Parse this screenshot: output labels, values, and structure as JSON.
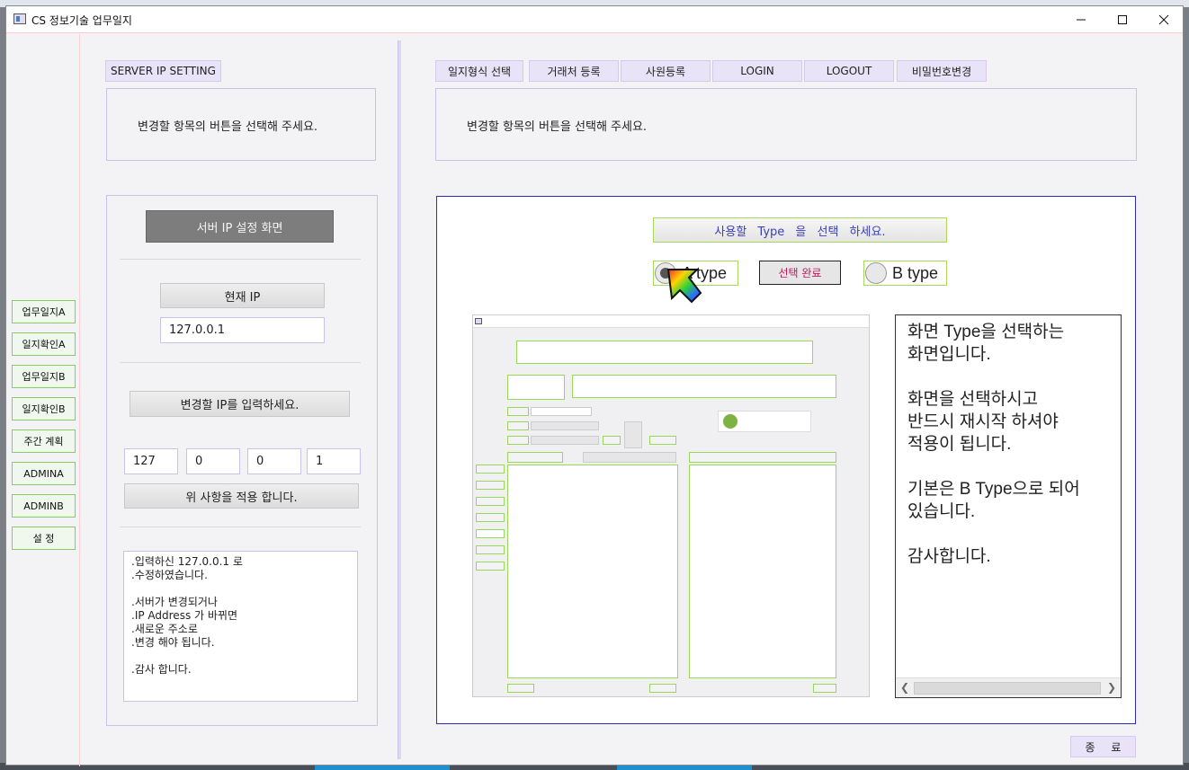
{
  "window": {
    "title": "CS 정보기술 업무일지"
  },
  "sidebar": {
    "items": [
      {
        "label": "업무일지A"
      },
      {
        "label": "일지확인A"
      },
      {
        "label": "업무일지B"
      },
      {
        "label": "일지확인B"
      },
      {
        "label": "주간 계획"
      },
      {
        "label": "ADMINA"
      },
      {
        "label": "ADMINB"
      },
      {
        "label": "설  정"
      }
    ]
  },
  "server": {
    "tab_label": "SERVER IP SETTING",
    "hint": "변경할 항목의 버튼을 선택해 주세요.",
    "screen_title": "서버 IP 설정 화면",
    "current_ip_label": "현재  IP",
    "current_ip_value": "127.0.0.1",
    "input_prompt": "변경할 IP를 입력하세요.",
    "octets": [
      "127",
      "0",
      "0",
      "1"
    ],
    "apply_label": "위 사항을 적용 합니다.",
    "message_lines": [
      ".입력하신 127.0.0.1 로",
      ".수정하였습니다.",
      "",
      ".서버가 변경되거나",
      ".IP Address 가 바뀌면",
      ".새로운 주소로",
      ".변경 해야 됩니다.",
      "",
      ".감사 합니다."
    ]
  },
  "toolbar": {
    "tabs": [
      {
        "label": "일지형식 선택"
      },
      {
        "label": "거래처 등록"
      },
      {
        "label": "사원등록"
      },
      {
        "label": "LOGIN"
      },
      {
        "label": "LOGOUT"
      },
      {
        "label": "비밀번호변경"
      }
    ],
    "hint": "변경할 항목의 버튼을 선택해 주세요."
  },
  "type_select": {
    "header": "사용할  Type  을  선택 하세요.",
    "option_a": "A type",
    "option_b": "B type",
    "selected": "A type",
    "confirm_label": "선택 완료",
    "description_lines": [
      "화면 Type을 선택하는",
      "화면입니다.",
      "",
      "화면을 선택하시고",
      "반드시 재시작 하셔야",
      "적용이 됩니다.",
      "",
      "기본은 B Type으로 되어",
      "있습니다.",
      "",
      "감사합니다."
    ]
  },
  "exit_label": "종 료",
  "colors": {
    "accent_green": "#84d05f",
    "panel_border": "#2b2bb7",
    "title_accent": "#3b3fb8",
    "confirm_text": "#c2185b"
  }
}
